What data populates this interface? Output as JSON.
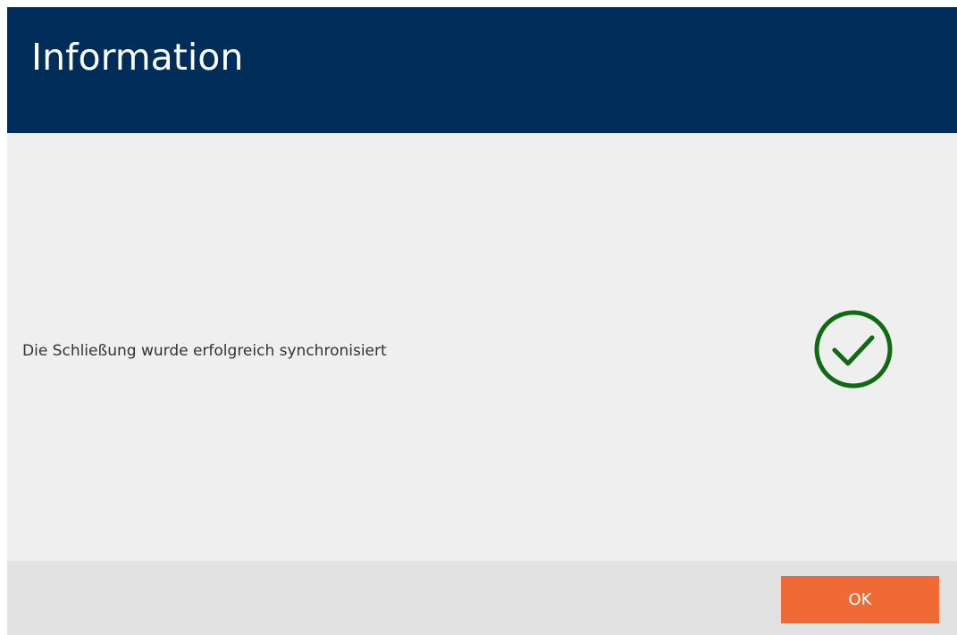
{
  "dialog": {
    "title": "Information",
    "message": "Die Schließung wurde erfolgreich synchronisiert",
    "status_icon": "check-circle-icon",
    "ok_label": "OK"
  },
  "colors": {
    "header_background": "#002d5a",
    "body_background": "#efefef",
    "footer_background": "#e1e1e1",
    "accent_button": "#ef6a35",
    "success_icon": "#0f6b12",
    "title_text": "#ffffff",
    "message_text": "#333333"
  }
}
